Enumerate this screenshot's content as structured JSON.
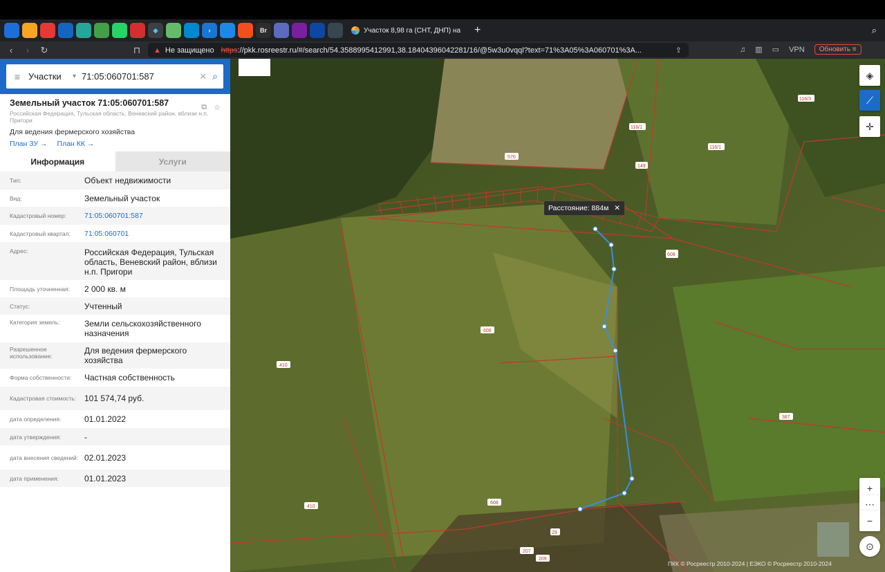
{
  "browser": {
    "tab_title": "Участок 8,98 га (СНТ, ДНП) на",
    "security_label": "Не защищено",
    "url_scheme": "https",
    "url_rest": "://pkk.rosreestr.ru/#/search/54.3588995412991,38.18404396042281/16/@5w3u0vqql?text=71%3A05%3A060701%3A...",
    "vpn_label": "VPN",
    "update_label": "Обновить"
  },
  "search": {
    "type_label": "Участки",
    "query": "71:05:060701:587"
  },
  "card": {
    "title": "Земельный участок 71:05:060701:587",
    "address_small": "Российская Федерация, Тульская область, Веневский район, вблизи н.п. Пригори",
    "purpose": "Для ведения фермерского хозяйства",
    "link_plan_zu": "План ЗУ",
    "link_plan_kk": "План КК"
  },
  "tabs": {
    "info": "Информация",
    "services": "Услуги"
  },
  "info_rows": [
    {
      "label": "Тип:",
      "value": "Объект недвижимости"
    },
    {
      "label": "Вид:",
      "value": "Земельный участок"
    },
    {
      "label": "Кадастровый номер:",
      "value": "71:05:060701:587"
    },
    {
      "label": "Кадастровый квартал:",
      "value": "71:05:060701"
    },
    {
      "label": "Адрес:",
      "value": "Российская Федерация, Тульская область, Веневский район, вблизи н.п. Пригори"
    },
    {
      "label": "Площадь уточненная:",
      "value": "2 000 кв. м"
    },
    {
      "label": "Статус:",
      "value": "Учтенный"
    },
    {
      "label": "Категория земель:",
      "value": "Земли сельскохозяйственного назначения"
    },
    {
      "label": "Разрешенное использование:",
      "value": "Для ведения фермерского хозяйства"
    },
    {
      "label": "Форма собственности:",
      "value": "Частная собственность"
    },
    {
      "label": "Кадастровая стоимость:",
      "value": "101 574,74 руб."
    },
    {
      "label": "дата определения:",
      "value": "01.01.2022"
    },
    {
      "label": "дата утверждения:",
      "value": "-"
    },
    {
      "label": "дата внесения сведений:",
      "value": "02.01.2023"
    },
    {
      "label": "дата применения:",
      "value": "01.01.2023"
    }
  ],
  "map": {
    "distance_label": "Расстояние: 884м",
    "copyright": "ПКК © Росреестр 2010-2024 | ЕЭКО © Росреестр 2010-2024",
    "parcel_labels": [
      "570",
      "116/1",
      "116/1",
      "116/3",
      "149",
      "608",
      "608",
      "608",
      "410",
      "410",
      "387",
      "29",
      "207",
      "209"
    ]
  }
}
